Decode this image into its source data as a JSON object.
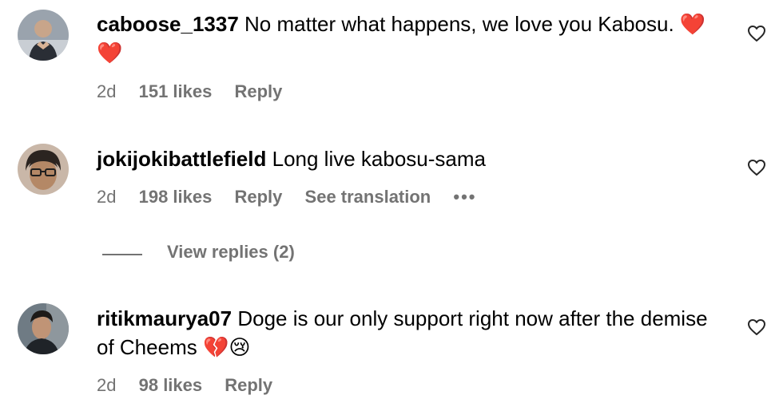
{
  "comments": [
    {
      "username": "caboose_1337",
      "text": "No matter what happens, we love you Kabosu. ❤️❤️",
      "time": "2d",
      "likes": "151 likes",
      "reply": "Reply",
      "avatar_icon": "avatar-heart-hands"
    },
    {
      "username": "jokijokibattlefield",
      "text": "Long live kabosu-sama",
      "time": "2d",
      "likes": "198 likes",
      "reply": "Reply",
      "translation": "See translation",
      "more": "•••",
      "avatar_icon": "avatar-glasses"
    },
    {
      "username": "ritikmaurya07",
      "text": "Doge is our only support right now after the demise of Cheems 💔😢",
      "time": "2d",
      "likes": "98 likes",
      "reply": "Reply",
      "avatar_icon": "avatar-portrait"
    }
  ],
  "view_replies": "View replies (2)",
  "colors": {
    "text": "#000000",
    "meta": "#737373",
    "background": "#ffffff"
  },
  "icons": {
    "like": "heart-outline-icon"
  }
}
